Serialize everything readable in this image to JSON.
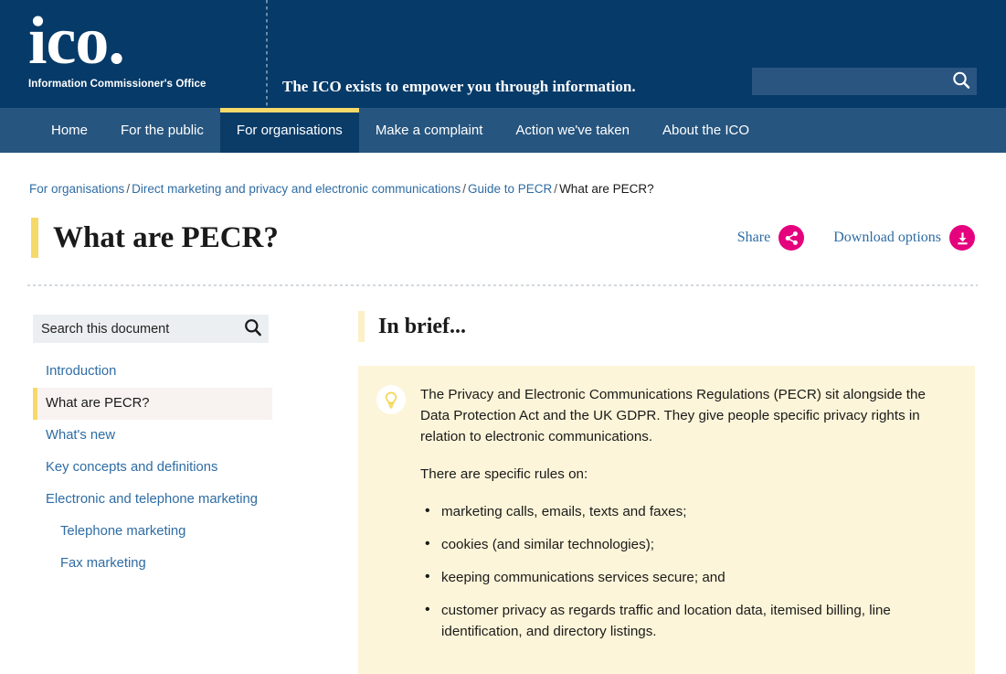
{
  "header": {
    "logo_mark": "ico.",
    "logo_subtitle": "Information Commissioner's Office",
    "tagline": "The ICO exists to empower you through information.",
    "search": {
      "value": "",
      "placeholder": "",
      "icon": "search-icon"
    },
    "colors": {
      "header_bg": "#063a68",
      "nav_bg": "#26557f",
      "nav_active_bg": "#0b3c68",
      "accent_yellow": "#f5d96a",
      "accent_pink": "#e5007d",
      "link_blue": "#2e6ca4"
    }
  },
  "nav": {
    "items": [
      {
        "label": "Home",
        "active": false
      },
      {
        "label": "For the public",
        "active": false
      },
      {
        "label": "For organisations",
        "active": true
      },
      {
        "label": "Make a complaint",
        "active": false
      },
      {
        "label": "Action we've taken",
        "active": false
      },
      {
        "label": "About the ICO",
        "active": false
      }
    ]
  },
  "breadcrumb": {
    "items": [
      "For organisations",
      "Direct marketing and privacy and electronic communications",
      "Guide to PECR"
    ],
    "current": "What are PECR?",
    "separator": "/"
  },
  "page": {
    "title": "What are PECR?"
  },
  "actions": {
    "share_label": "Share",
    "share_icon": "share-icon",
    "download_label": "Download options",
    "download_icon": "download-icon"
  },
  "sidebar": {
    "search": {
      "value": "",
      "placeholder": "Search this document",
      "icon": "search-icon"
    },
    "items": [
      {
        "label": "Introduction",
        "active": false,
        "sub": false
      },
      {
        "label": "What are PECR?",
        "active": true,
        "sub": false
      },
      {
        "label": "What's new",
        "active": false,
        "sub": false
      },
      {
        "label": "Key concepts and definitions",
        "active": false,
        "sub": false
      },
      {
        "label": "Electronic and telephone marketing",
        "active": false,
        "sub": false
      },
      {
        "label": "Telephone marketing",
        "active": false,
        "sub": true
      },
      {
        "label": "Fax marketing",
        "active": false,
        "sub": true
      }
    ]
  },
  "main": {
    "section_title": "In brief...",
    "callout": {
      "icon": "lightbulb-icon",
      "paragraphs": [
        "The Privacy and Electronic Communications Regulations (PECR) sit alongside the Data Protection Act and the UK GDPR. They give people specific privacy rights in relation to electronic communications.",
        "There are specific rules on:"
      ],
      "bullets": [
        "marketing calls, emails, texts and faxes;",
        "cookies (and similar technologies);",
        "keeping communications services secure; and",
        "customer privacy as regards traffic and location data, itemised billing, line identification, and directory listings."
      ]
    }
  }
}
